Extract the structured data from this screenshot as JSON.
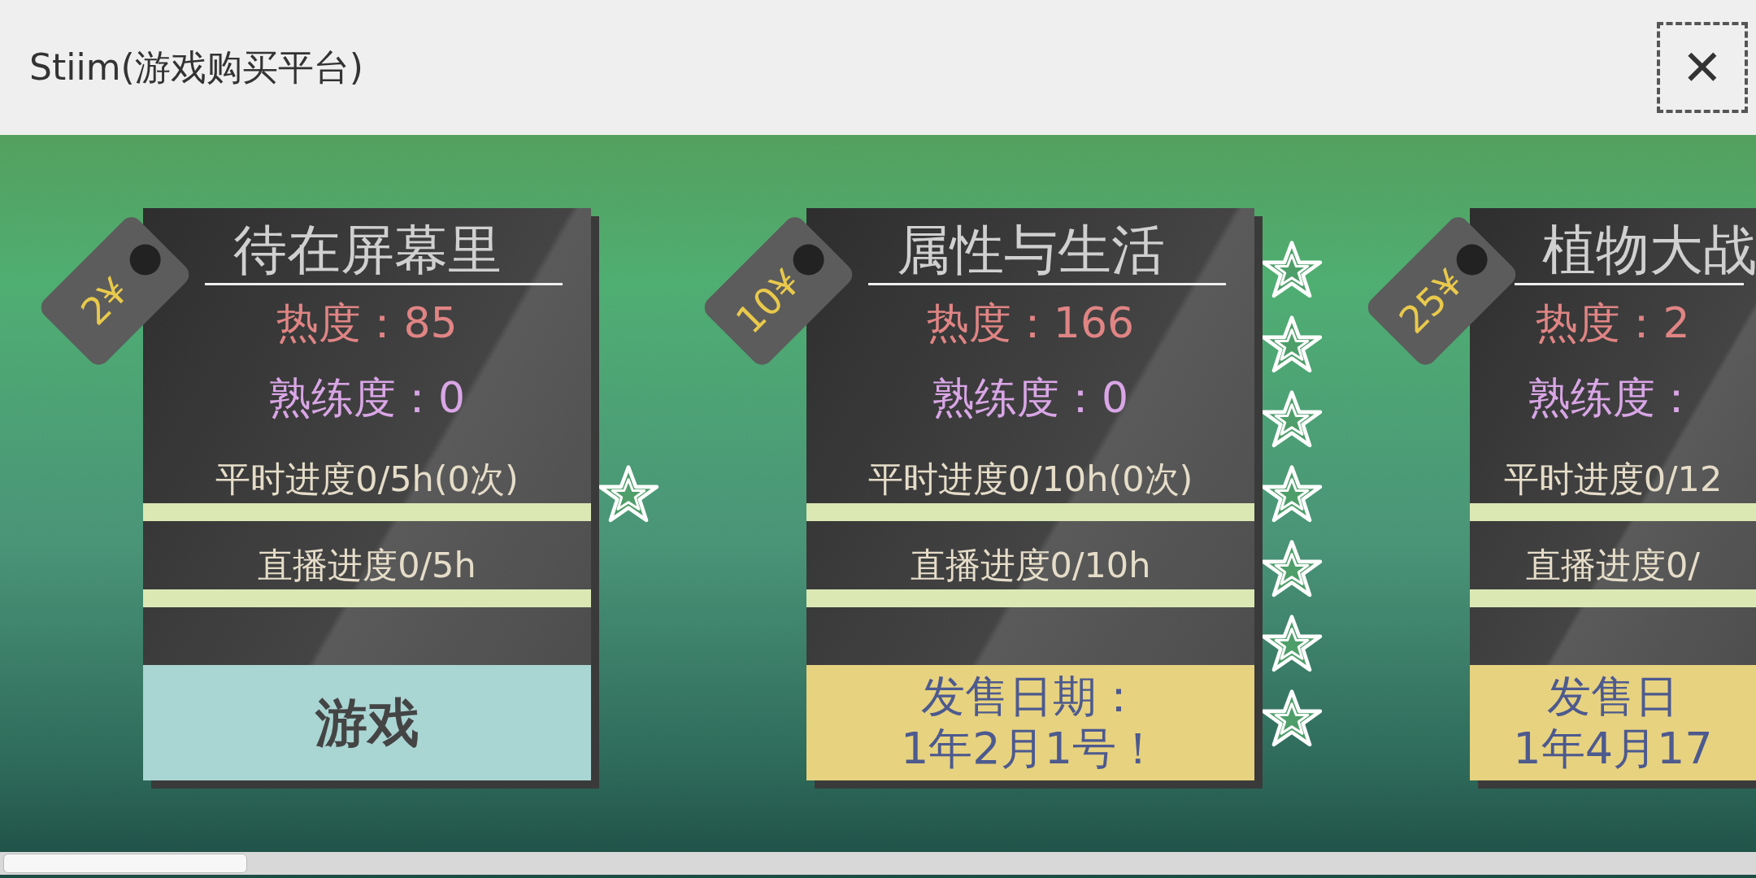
{
  "window": {
    "title": "Stiim(游戏购买平台)",
    "close": "✕"
  },
  "games": [
    {
      "price": "2¥",
      "title": "待在屏幕里",
      "heat": "热度：85",
      "skill": "熟练度：0",
      "progress": [
        {
          "label": "平时进度0/5h(0次)"
        },
        {
          "label": "直播进度0/5h"
        }
      ],
      "action": {
        "kind": "play",
        "lines": [
          "游戏"
        ]
      },
      "icons": [
        {
          "kind": "star"
        }
      ]
    },
    {
      "price": "10¥",
      "title": "属性与生活",
      "heat": "热度：166",
      "skill": "熟练度：0",
      "progress": [
        {
          "label": "平时进度0/10h(0次)"
        },
        {
          "label": "直播进度0/10h"
        }
      ],
      "action": {
        "kind": "release",
        "lines": [
          "发售日期：",
          "1年2月1号！"
        ]
      },
      "icons": [
        {
          "kind": "star"
        },
        {
          "kind": "star"
        },
        {
          "kind": "star"
        },
        {
          "kind": "star"
        },
        {
          "kind": "star"
        },
        {
          "kind": "star"
        },
        {
          "kind": "star"
        }
      ]
    },
    {
      "price": "25¥",
      "title": "植物大战",
      "heat": "热度：2",
      "skill": "熟练度：",
      "progress": [
        {
          "label": "平时进度0/12"
        },
        {
          "label": "直播进度0/"
        }
      ],
      "action": {
        "kind": "release",
        "lines": [
          "发售日",
          "1年4月17"
        ]
      }
    }
  ]
}
